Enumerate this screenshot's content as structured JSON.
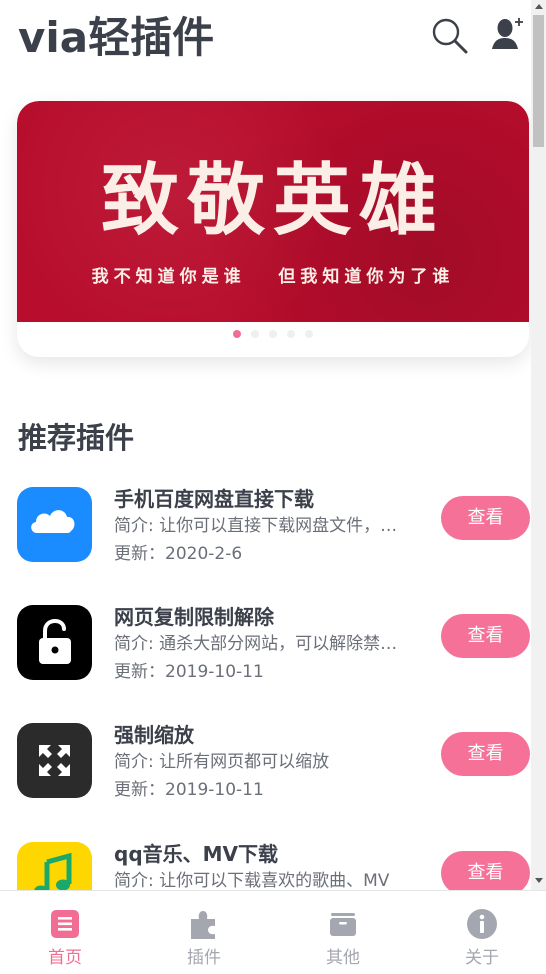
{
  "header": {
    "title": "via轻插件",
    "search_icon": "search-icon",
    "user_icon": "user-add-icon"
  },
  "banner": {
    "heading": "致敬英雄",
    "subtitle": "我不知道你是谁   但我知道你为了谁",
    "slide_count": 5,
    "active_slide": 1,
    "background_color": "#b80d2c"
  },
  "section": {
    "title": "推荐插件"
  },
  "plugins": [
    {
      "name": "手机百度网盘直接下载",
      "desc": "简介: 让你可以直接下载网盘文件，无需客户端",
      "date": "更新：2020-2-6",
      "button": "查看",
      "icon": "cloud-icon",
      "icon_bg": "#1a8cff"
    },
    {
      "name": "网页复制限制解除",
      "desc": "简介: 通杀大部分网站，可以解除禁止复制",
      "date": "更新：2019-10-11",
      "button": "查看",
      "icon": "unlock-icon",
      "icon_bg": "#000000"
    },
    {
      "name": "强制缩放",
      "desc": "简介: 让所有网页都可以缩放",
      "date": "更新：2019-10-11",
      "button": "查看",
      "icon": "expand-arrows-icon",
      "icon_bg": "#2b2b2b"
    },
    {
      "name": "qq音乐、MV下载",
      "desc": "简介: 让你可以下载喜欢的歌曲、MV",
      "date": "",
      "button": "查看",
      "icon": "music-note-icon",
      "icon_bg": "#ffd700"
    }
  ],
  "nav": [
    {
      "label": "首页",
      "icon": "document-icon",
      "active": true
    },
    {
      "label": "插件",
      "icon": "puzzle-icon",
      "active": false
    },
    {
      "label": "其他",
      "icon": "box-icon",
      "active": false
    },
    {
      "label": "关于",
      "icon": "info-icon",
      "active": false
    }
  ],
  "colors": {
    "accent": "#f57198",
    "active_nav": "#f26d93",
    "inactive_nav": "#a4a7b0",
    "title": "#3b404a"
  }
}
